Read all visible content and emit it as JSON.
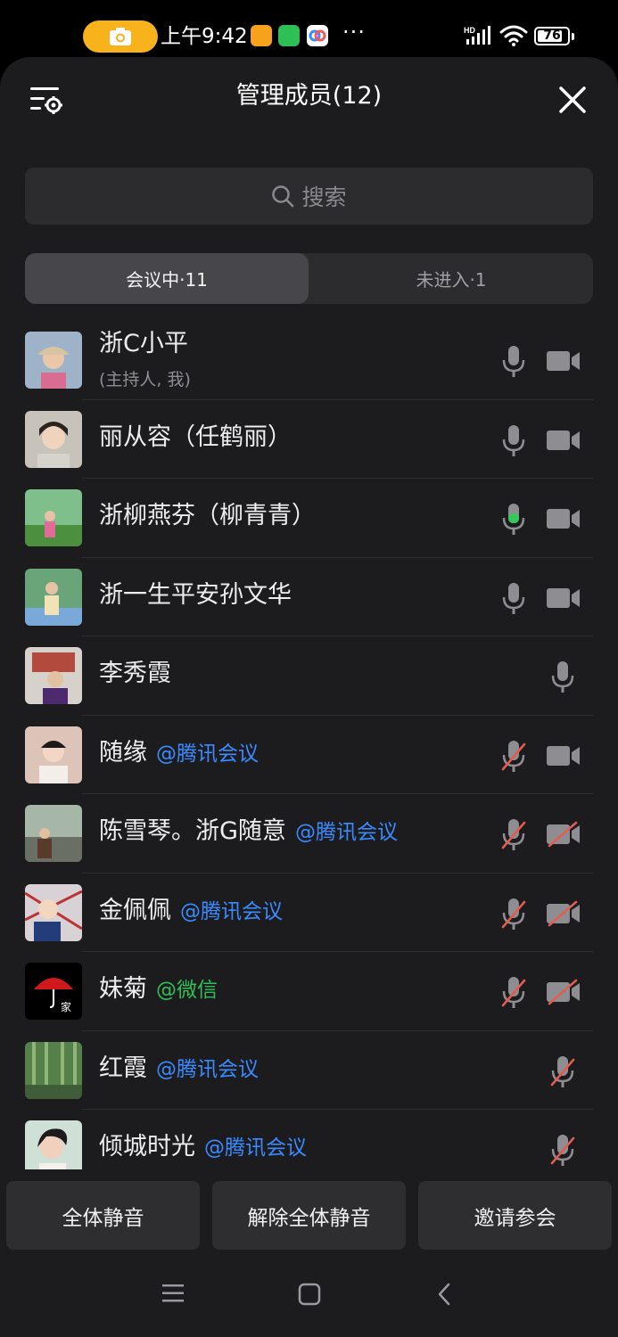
{
  "status_bar": {
    "time": "上午9:42",
    "battery": "76",
    "network": "HD"
  },
  "header": {
    "title": "管理成员(12)"
  },
  "search": {
    "placeholder": "搜索"
  },
  "tabs": [
    {
      "label": "会议中·11",
      "active": true
    },
    {
      "label": "未进入·1",
      "active": false
    }
  ],
  "members": [
    {
      "name": "浙C小平",
      "sub": "(主持人, 我)",
      "tag": "",
      "mic": "on",
      "camera": "on"
    },
    {
      "name": "丽从容（任鹤丽）",
      "tag": "",
      "mic": "on",
      "camera": "on"
    },
    {
      "name": "浙柳燕芬（柳青青）",
      "tag": "",
      "mic": "speaking",
      "camera": "on"
    },
    {
      "name": "浙一生平安孙文华",
      "tag": "",
      "mic": "on",
      "camera": "on"
    },
    {
      "name": "李秀霞",
      "tag": "",
      "mic": "on",
      "camera": "none"
    },
    {
      "name": "随缘",
      "tag": "@腾讯会议",
      "tag_type": "tencent",
      "mic": "muted",
      "camera": "on"
    },
    {
      "name": "陈雪琴。浙G随意",
      "tag": "@腾讯会议",
      "tag_type": "tencent",
      "mic": "muted",
      "camera": "off"
    },
    {
      "name": "金佩佩",
      "tag": "@腾讯会议",
      "tag_type": "tencent",
      "mic": "muted",
      "camera": "off"
    },
    {
      "name": "妹菊",
      "tag": "@微信",
      "tag_type": "wechat",
      "mic": "muted",
      "camera": "off"
    },
    {
      "name": "红霞",
      "tag": "@腾讯会议",
      "tag_type": "tencent",
      "mic": "muted",
      "camera": "none"
    },
    {
      "name": "倾城时光",
      "tag": "@腾讯会议",
      "tag_type": "tencent",
      "mic": "muted",
      "camera": "none"
    }
  ],
  "actions": {
    "mute_all": "全体静音",
    "unmute_all": "解除全体静音",
    "invite": "邀请参会"
  },
  "colors": {
    "background": "#1c1c1e",
    "accent_tencent": "#3a8bff",
    "accent_wechat": "#2fbf57",
    "speaking": "#35c759",
    "muted": "#e25c4f"
  },
  "icons": [
    "camera-icon",
    "settings-icon",
    "close-icon",
    "search-icon",
    "microphone-icon",
    "video-icon",
    "menu-icon",
    "home-icon",
    "back-icon"
  ]
}
